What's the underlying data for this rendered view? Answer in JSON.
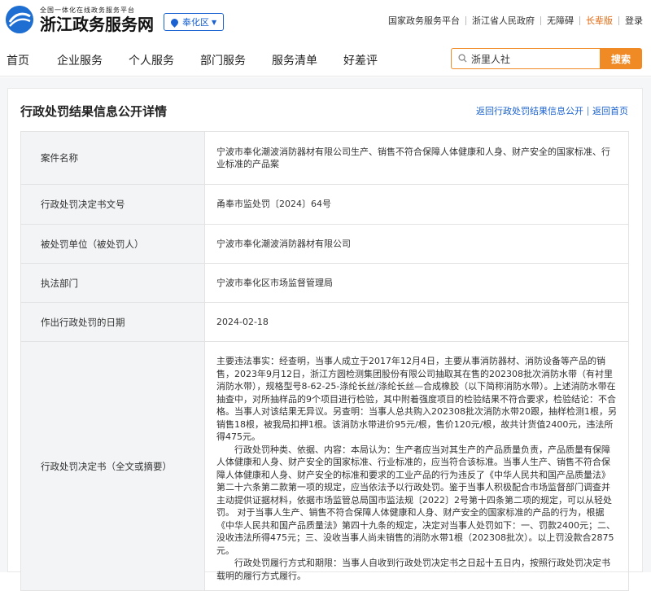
{
  "header": {
    "subtitle": "全国一体化在线政务服务平台",
    "site_name": "浙江政务服务网",
    "region_label": "奉化区",
    "links": [
      "国家政务服务平台",
      "浙江省人民政府",
      "无障碍",
      "长辈版",
      "登录"
    ],
    "accent": "#1a62d1",
    "orange": "#f08a24"
  },
  "nav": {
    "items": [
      "首页",
      "企业服务",
      "个人服务",
      "部门服务",
      "服务清单",
      "好差评"
    ],
    "search_value": "浙里人社",
    "search_button": "搜索"
  },
  "page": {
    "title": "行政处罚结果信息公开详情",
    "back_list_link": "返回行政处罚结果信息公开",
    "back_home_link": "返回首页"
  },
  "rows": [
    {
      "label": "案件名称",
      "value": "宁波市奉化潮波消防器材有限公司生产、销售不符合保障人体健康和人身、财产安全的国家标准、行业标准的产品案"
    },
    {
      "label": "行政处罚决定书文号",
      "value": "甬奉市监处罚〔2024〕64号"
    },
    {
      "label": "被处罚单位（被处罚人）",
      "value": "宁波市奉化潮波消防器材有限公司"
    },
    {
      "label": "执法部门",
      "value": "宁波市奉化区市场监督管理局"
    },
    {
      "label": "作出行政处罚的日期",
      "value": "2024-02-18"
    }
  ],
  "decision": {
    "label": "行政处罚决定书（全文或摘要）",
    "paragraphs": [
      "主要违法事实：经查明，当事人成立于2017年12月4日，主要从事消防器材、消防设备等产品的销售，2023年9月12日，浙江方圆检测集团股份有限公司抽取其在售的202308批次消防水带（有衬里消防水带），规格型号8-62-25-涤纶长丝/涤纶长丝—合成橡胶（以下简称消防水带）。上述消防水带在抽查中，对所抽样品的9个项目进行检验，其中附着强度项目的检验结果不符合要求，检验结论：不合格。当事人对该结果无异议。另查明：当事人总共购入202308批次消防水带20跟，抽样检测1根，另销售18根，被我局扣押1根。该消防水带进价95元/根，售价120元/根，故共计货值2400元，违法所得475元。",
      "行政处罚种类、依据、内容：本局认为：生产者应当对其生产的产品质量负责，产品质量有保障人体健康和人身、财产安全的国家标准、行业标准的，应当符合该标准。当事人生产、销售不符合保障人体健康和人身、财产安全的标准和要求的工业产品的行为违反了《中华人民共和国产品质量法》第二十六条第二款第一项的规定，应当依法予以行政处罚。鉴于当事人积极配合市场监督部门调查并主动提供证据材料，依据市场监管总局国市监法规〔2022〕2号第十四条第二项的规定，可以从轻处罚。 对于当事人生产、销售不符合保障人体健康和人身、财产安全的国家标准的产品的行为，根据《中华人民共和国产品质量法》第四十九条的规定，决定对当事人处罚如下：一、罚款2400元；二、没收违法所得475元；三、没收当事人尚未销售的消防水带1根（202308批次）。以上罚没款合2875元。",
      "行政处罚履行方式和期限：当事人自收到行政处罚决定书之日起十五日内，按照行政处罚决定书载明的履行方式履行。"
    ]
  }
}
